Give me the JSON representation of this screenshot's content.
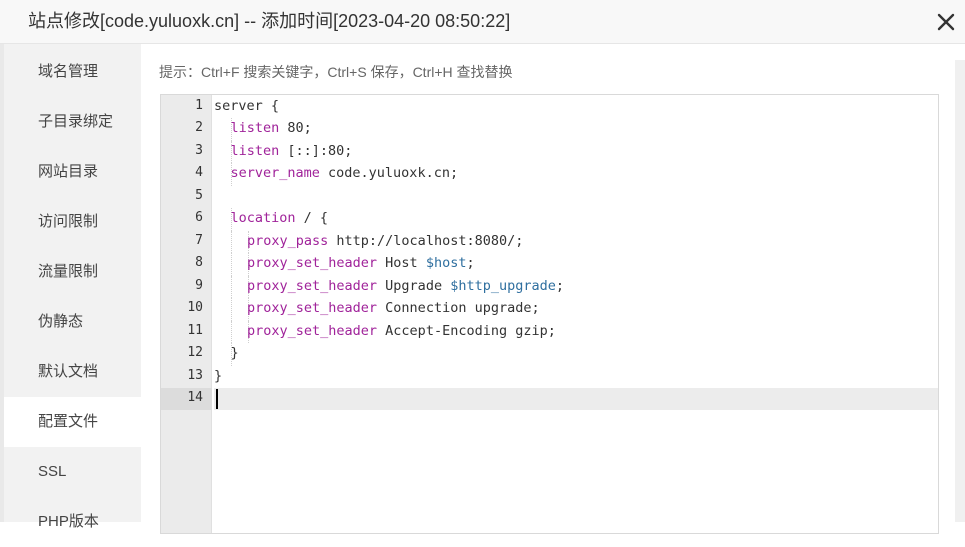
{
  "dialog": {
    "title": "站点修改[code.yuluoxk.cn] -- 添加时间[2023-04-20 08:50:22]"
  },
  "sidebar": {
    "items": [
      {
        "label": "域名管理",
        "active": false
      },
      {
        "label": "子目录绑定",
        "active": false
      },
      {
        "label": "网站目录",
        "active": false
      },
      {
        "label": "访问限制",
        "active": false
      },
      {
        "label": "流量限制",
        "active": false
      },
      {
        "label": "伪静态",
        "active": false
      },
      {
        "label": "默认文档",
        "active": false
      },
      {
        "label": "配置文件",
        "active": true
      },
      {
        "label": "SSL",
        "active": false
      },
      {
        "label": "PHP版本",
        "active": false
      }
    ]
  },
  "editor": {
    "hint": "提示：Ctrl+F 搜索关键字，Ctrl+S 保存，Ctrl+H 查找替换",
    "active_line": 14,
    "lines": [
      [
        {
          "t": "server {"
        }
      ],
      [
        {
          "t": "listen",
          "c": "kw"
        },
        {
          "t": " 80;"
        }
      ],
      [
        {
          "t": "listen",
          "c": "kw"
        },
        {
          "t": " [::]:80;"
        }
      ],
      [
        {
          "t": "server_name",
          "c": "kw"
        },
        {
          "t": " code.yuluoxk.cn;"
        }
      ],
      [],
      [
        {
          "t": "location",
          "c": "kw"
        },
        {
          "t": " / {"
        }
      ],
      [
        {
          "t": "proxy_pass",
          "c": "kw"
        },
        {
          "t": " http://localhost:8080/;"
        }
      ],
      [
        {
          "t": "proxy_set_header",
          "c": "kw"
        },
        {
          "t": " Host "
        },
        {
          "t": "$host",
          "c": "var"
        },
        {
          "t": ";"
        }
      ],
      [
        {
          "t": "proxy_set_header",
          "c": "kw"
        },
        {
          "t": " Upgrade "
        },
        {
          "t": "$http_upgrade",
          "c": "var"
        },
        {
          "t": ";"
        }
      ],
      [
        {
          "t": "proxy_set_header",
          "c": "kw"
        },
        {
          "t": " Connection upgrade;"
        }
      ],
      [
        {
          "t": "proxy_set_header",
          "c": "kw"
        },
        {
          "t": " Accept-Encoding gzip;"
        }
      ],
      [
        {
          "t": "}"
        }
      ],
      [
        {
          "t": "}"
        }
      ],
      []
    ]
  },
  "colors": {
    "keyword": "#a0239a",
    "variable": "#2f6f9f",
    "sidebar_bg": "#f2f2f2",
    "gutter_bg": "#ebebeb"
  }
}
